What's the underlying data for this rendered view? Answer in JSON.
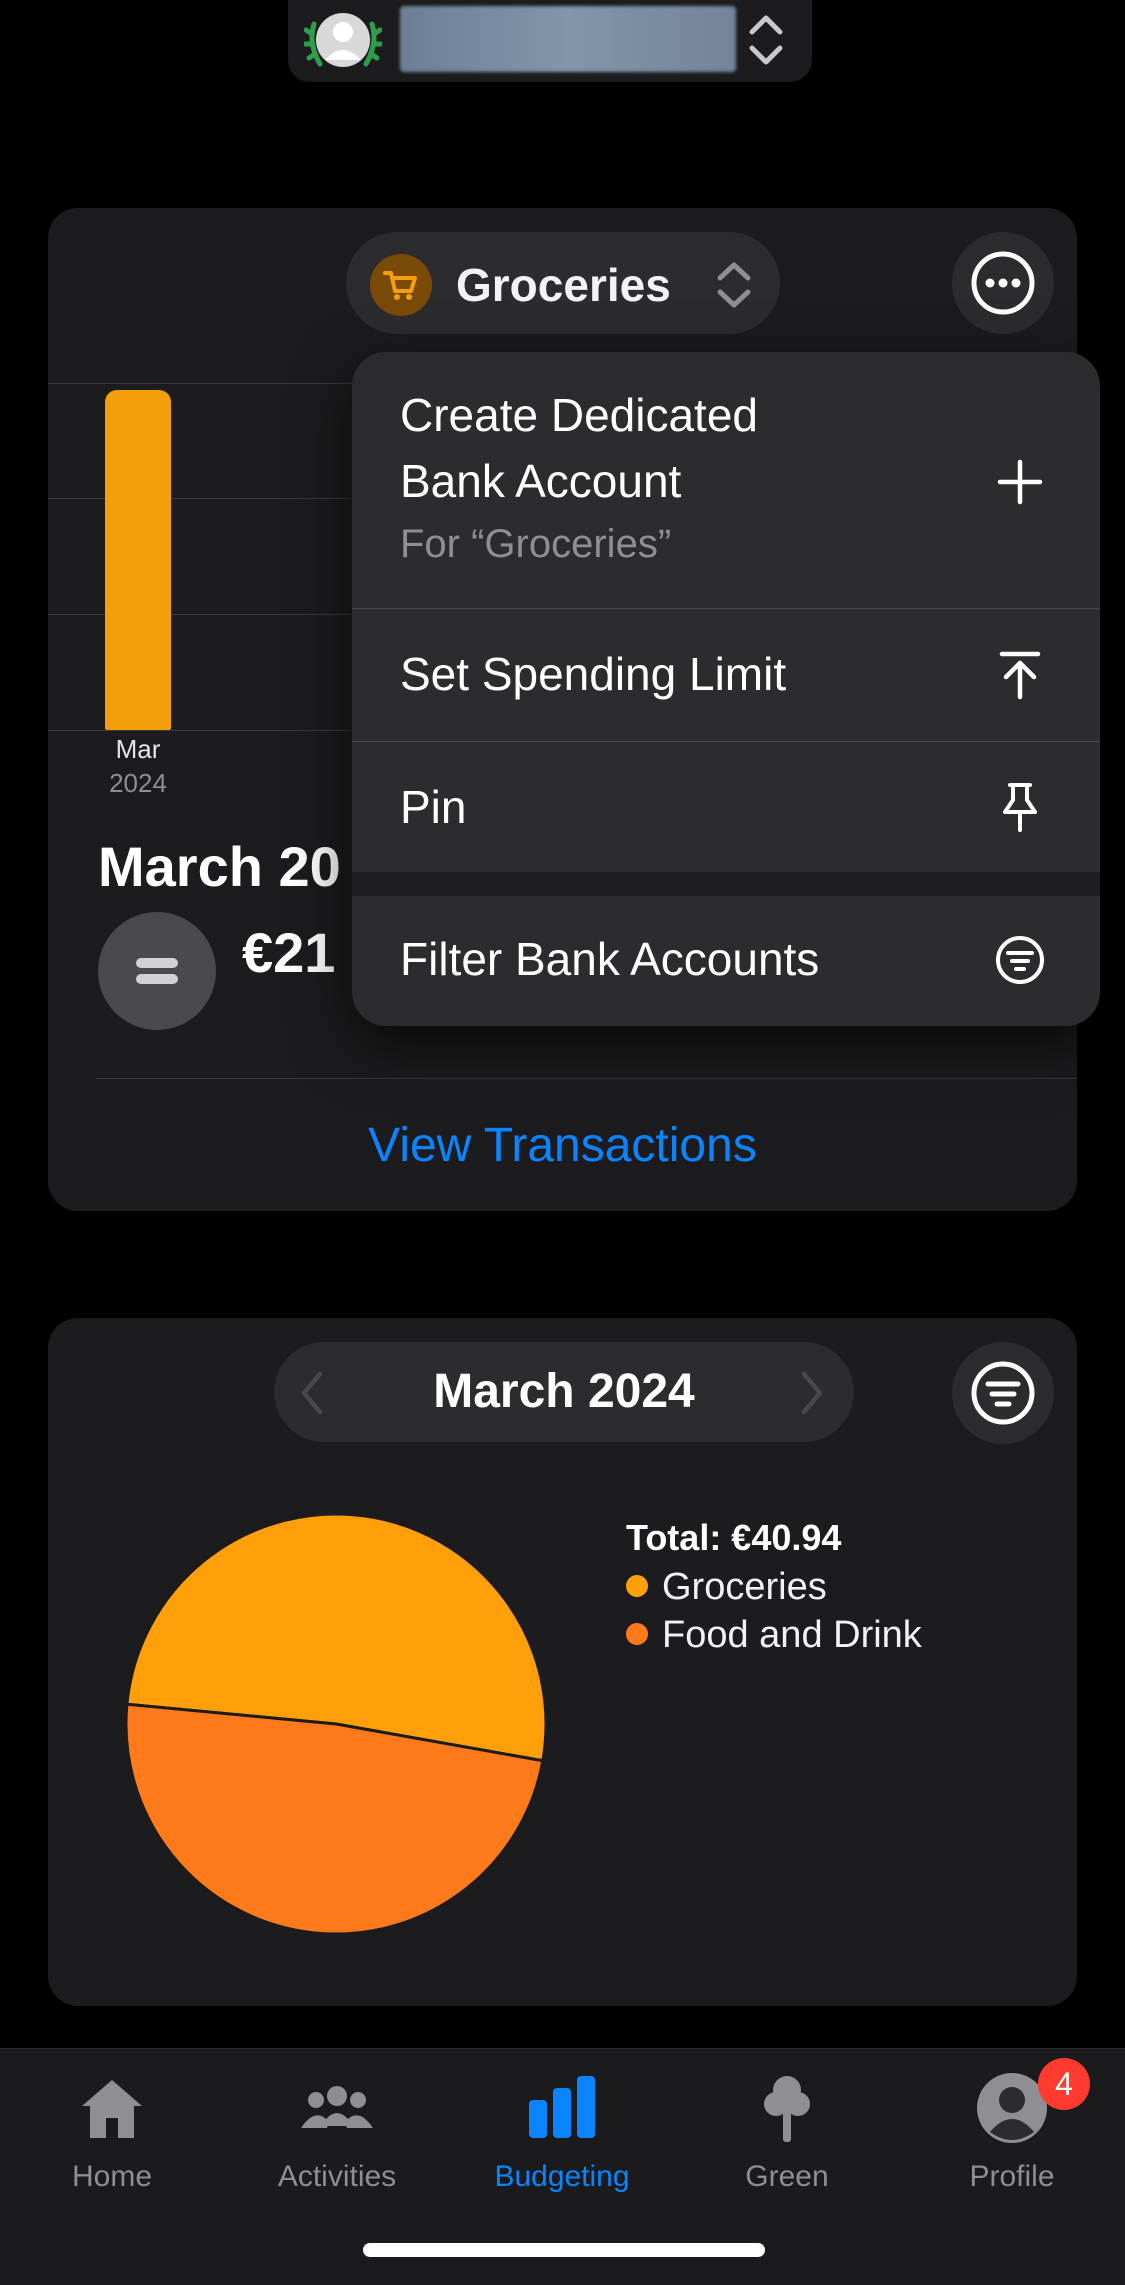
{
  "account_switcher": {
    "avatar_icon": "user-avatar-laurel-icon",
    "chevron_icon": "chevron-up-down-icon"
  },
  "budget_card": {
    "category": {
      "label": "Groceries",
      "icon": "shopping-cart-icon",
      "color": "#f59e0b"
    },
    "chart": {
      "type": "bar",
      "categories": [
        "Mar"
      ],
      "years": [
        "2024"
      ],
      "values_relative": [
        1.0
      ]
    },
    "period_title": "March 20",
    "amount": "€21",
    "view_transactions": "View Transactions"
  },
  "context_menu": {
    "items": [
      {
        "label_line1": "Create Dedicated",
        "label_line2": "Bank Account",
        "subtitle": "For “Groceries”",
        "icon": "plus-icon"
      },
      {
        "label": "Set Spending Limit",
        "icon": "arrow-up-to-line-icon"
      },
      {
        "label": "Pin",
        "icon": "pin-icon"
      },
      {
        "label": "Filter Bank Accounts",
        "icon": "filter-circle-icon"
      }
    ]
  },
  "spending_card": {
    "month_label": "March 2024",
    "legend_total": "Total: €40.94",
    "legend": [
      {
        "name": "Groceries",
        "color": "#ff9f0a"
      },
      {
        "name": "Food and Drink",
        "color": "#ff7a1a"
      }
    ]
  },
  "chart_data": {
    "type": "pie",
    "title": "",
    "total_label": "Total: €40.94",
    "series": [
      {
        "name": "Groceries",
        "value_share": 0.513,
        "color": "#ff9f0a"
      },
      {
        "name": "Food and Drink",
        "value_share": 0.487,
        "color": "#ff7a1a"
      }
    ],
    "legend_position": "right"
  },
  "tabbar": {
    "tabs": [
      {
        "label": "Home",
        "icon": "house-icon"
      },
      {
        "label": "Activities",
        "icon": "people-icon"
      },
      {
        "label": "Budgeting",
        "icon": "bar-chart-icon",
        "active": true
      },
      {
        "label": "Green",
        "icon": "tree-icon"
      },
      {
        "label": "Profile",
        "icon": "profile-icon",
        "badge": "4"
      }
    ]
  }
}
